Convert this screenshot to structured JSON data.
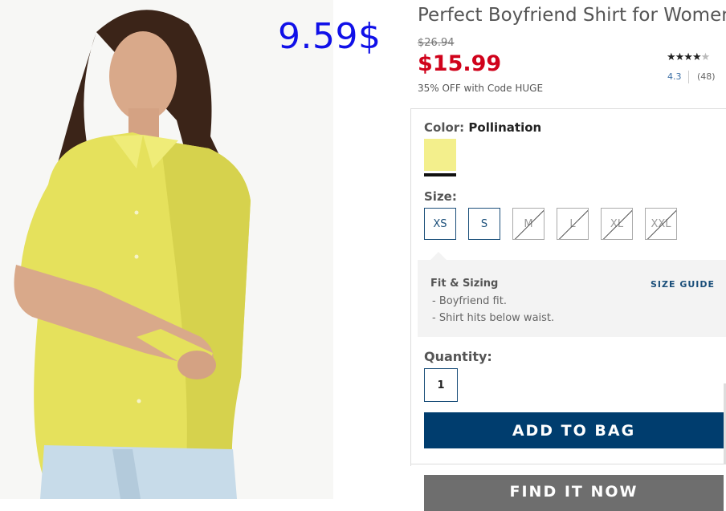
{
  "overlay_price": "9.59$",
  "product": {
    "title": "Perfect Boyfriend Shirt for Women",
    "original_price": "$26.94",
    "sale_price": "$15.99",
    "promo": "35% OFF with Code HUGE",
    "rating_value": "4.3",
    "review_count": "(48)",
    "stars_full": "★★★★",
    "stars_half": "★"
  },
  "color": {
    "label": "Color:",
    "value": "Pollination",
    "swatch_color": "#f3ef8c"
  },
  "size": {
    "label": "Size:",
    "options": [
      "XS",
      "S",
      "M",
      "L",
      "XL",
      "XXL"
    ]
  },
  "fit": {
    "title": "Fit & Sizing",
    "guide_link": "SIZE GUIDE",
    "items": [
      "- Boyfriend fit.",
      "- Shirt hits below waist."
    ]
  },
  "quantity": {
    "label": "Quantity:",
    "value": "1"
  },
  "buttons": {
    "add_to_bag": "ADD TO BAG",
    "find_it_now": "FIND IT NOW"
  }
}
